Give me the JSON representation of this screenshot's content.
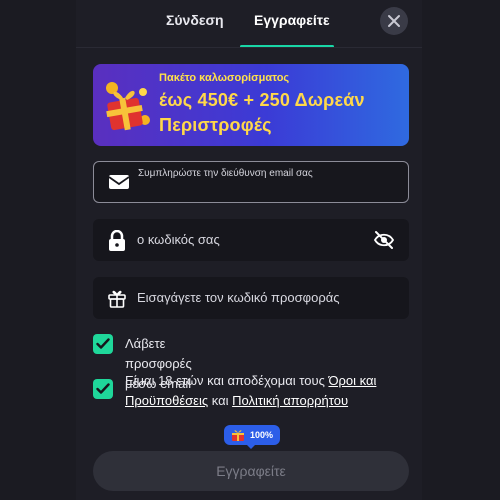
{
  "tabs": {
    "login_label": "Σύνδεση",
    "register_label": "Εγγραφείτε",
    "active": "register"
  },
  "promo": {
    "subtitle": "Πακέτο καλωσορίσματος",
    "headline": "έως 450€ + 250 Δωρεάν Περιστροφές",
    "icon": "gift-box-illustration"
  },
  "form": {
    "email_label": "Συμπληρώστε την διεύθυνση email σας",
    "password_placeholder": "ο κωδικός σας",
    "promo_code_placeholder": "Εισαγάγετε τον κωδικό προσφοράς",
    "offers_checkbox": {
      "checked": true,
      "label": "Λάβετε προσφορές μέσω email"
    },
    "terms_checkbox": {
      "checked": true,
      "text_before": "Είμαι 18 ετών και αποδέχομαι τους ",
      "terms_link": "Όροι και Προϋποθέσεις",
      "text_middle": " και ",
      "privacy_link": "Πολιτική απορρήτου"
    },
    "progress_badge": "100%",
    "submit_label": "Εγγραφείτε"
  },
  "colors": {
    "accent": "#19d6a6",
    "checkbox": "#1fd79a",
    "promo_text": "#ffd84a",
    "badge": "#2c5ee8"
  }
}
